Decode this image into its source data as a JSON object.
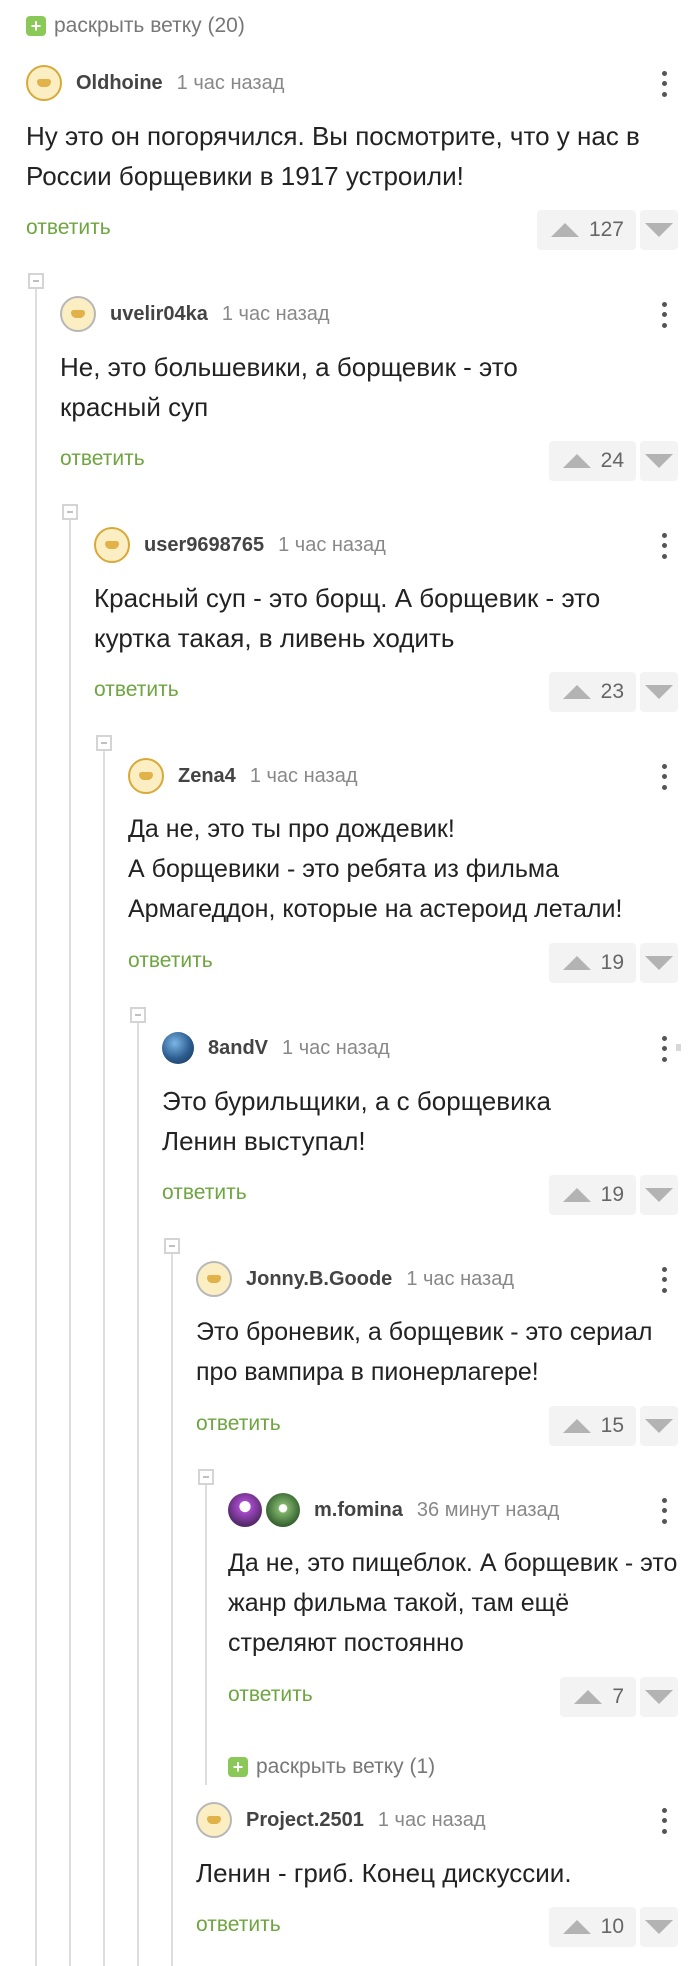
{
  "expand_top": {
    "label": "раскрыть ветку (20)"
  },
  "expand_inner": {
    "label": "раскрыть ветку (1)"
  },
  "reply_label": "ответить",
  "comments": [
    {
      "author": "Oldhoine",
      "time": "1 час назад",
      "text": "Ну это он погорячился. Вы посмотрите, что у нас в России борщевики в 1917 устроили!",
      "rating": "127"
    },
    {
      "author": "uvelir04ka",
      "time": "1 час назад",
      "text": "Не, это большевики, а борщевик - это красный суп",
      "rating": "24"
    },
    {
      "author": "user9698765",
      "time": "1 час назад",
      "text": "Красный суп - это борщ. А борщевик - это куртка такая, в ливень ходить",
      "rating": "23"
    },
    {
      "author": "Zena4",
      "time": "1 час назад",
      "text": "Да не, это ты про дождевик!\nА борщевики - это ребята из фильма Армагеддон, которые на астероид летали!",
      "rating": "19"
    },
    {
      "author": "8andV",
      "time": "1 час назад",
      "text": "Это бурильщики, а с борщевика Ленин выступал!",
      "rating": "19"
    },
    {
      "author": "Jonny.B.Goode",
      "time": "1 час назад",
      "text": "Это броневик, а борщевик - это сериал про вампира в пионерлагере!",
      "rating": "15"
    },
    {
      "author": "m.fomina",
      "time": "36 минут назад",
      "text": "Да не, это пищеблок. А борщевик - это жанр фильма такой, там ещё стреляют постоянно",
      "rating": "7"
    },
    {
      "author": "Project.2501",
      "time": "1 час назад",
      "text": "Ленин - гриб. Конец дискуссии.",
      "rating": "10"
    }
  ],
  "icons": {
    "plus": "plus-icon",
    "more": "more-vertical-icon",
    "upvote": "arrow-up-icon",
    "downvote": "arrow-down-icon",
    "collapse": "collapse-minus-icon"
  },
  "colors": {
    "accent_green": "#6ea540",
    "plus_green": "#8ac858",
    "rating_bg": "#f3f3f3",
    "thread_line": "#dddddd"
  }
}
